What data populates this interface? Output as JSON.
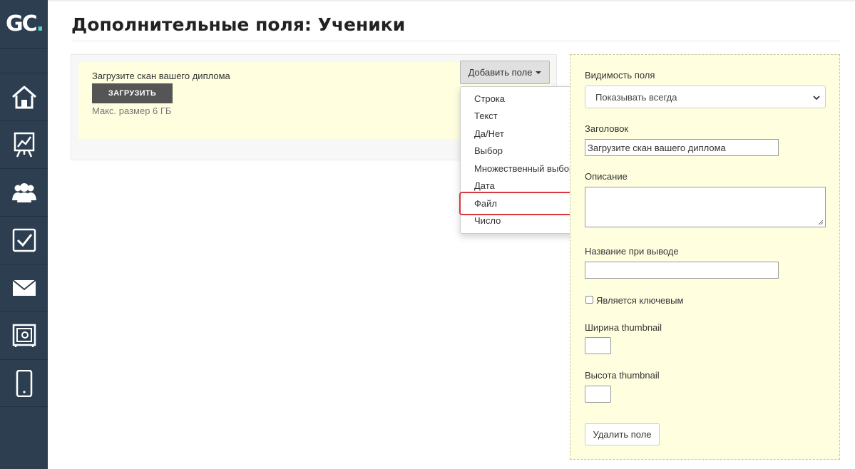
{
  "app": {
    "logo_letters": "GC",
    "logo_dot": "."
  },
  "sidebar": {
    "items": [
      {
        "name": "home",
        "icon": "home-icon"
      },
      {
        "name": "analytics",
        "icon": "chart-board-icon"
      },
      {
        "name": "users",
        "icon": "users-icon"
      },
      {
        "name": "tasks",
        "icon": "checkbox-icon"
      },
      {
        "name": "messages",
        "icon": "envelope-icon"
      },
      {
        "name": "safe",
        "icon": "safe-icon"
      },
      {
        "name": "mobile",
        "icon": "phone-icon"
      }
    ]
  },
  "header": {
    "title": "Дополнительные поля: Ученики"
  },
  "field_preview": {
    "label": "Загрузите скан вашего диплома",
    "upload_button": "ЗАГРУЗИТЬ",
    "hint": "Макс. размер 6 ГБ"
  },
  "add_field": {
    "button_label": "Добавить поле",
    "menu": [
      "Строка",
      "Текст",
      "Да/Нет",
      "Выбор",
      "Множественный выбор",
      "Дата",
      "Файл",
      "Число"
    ],
    "highlighted": "Файл"
  },
  "settings": {
    "visibility_label": "Видимость поля",
    "visibility_value": "Показывать всегда",
    "title_label": "Заголовок",
    "title_value": "Загрузите скан вашего диплома",
    "description_label": "Описание",
    "description_value": "",
    "output_name_label": "Название при выводе",
    "output_name_value": "",
    "is_key_label": "Является ключевым",
    "is_key_checked": false,
    "thumb_width_label": "Ширина thumbnail",
    "thumb_height_label": "Высота thumbnail",
    "delete_button": "Удалить поле"
  },
  "colors": {
    "sidebar": "#2c3e50",
    "highlight_panel": "#ffffe0",
    "accent_red": "#d9363e",
    "logo_dot": "#4fd1c5"
  }
}
